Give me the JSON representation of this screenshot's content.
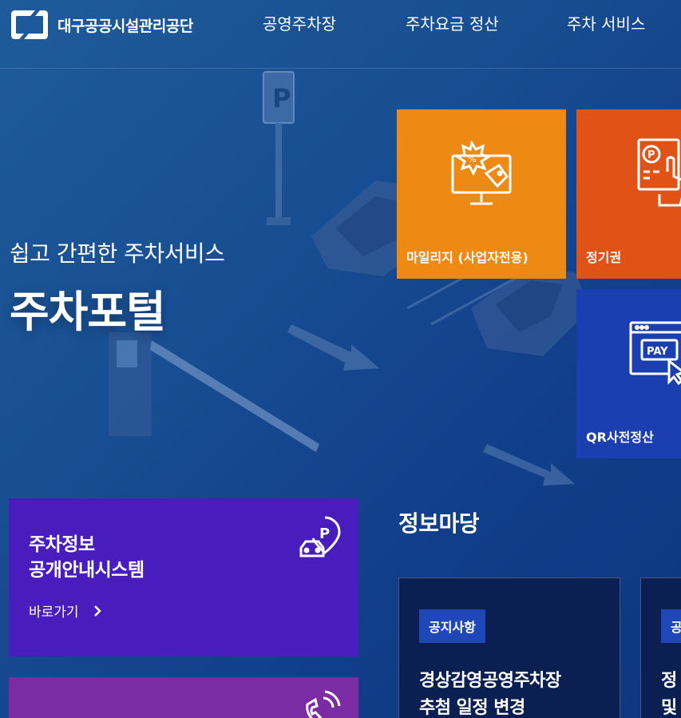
{
  "brand": {
    "name": "대구공공시설관리공단",
    "logo_icon": "brand-logo-icon"
  },
  "nav": [
    {
      "label": "공영주차장"
    },
    {
      "label": "주차요금 정산"
    },
    {
      "label": "주차 서비스"
    }
  ],
  "hero": {
    "subtitle": "쉽고 간편한 주차서비스",
    "title": "주차포털"
  },
  "tiles": [
    {
      "label": "마일리지 (사업자전용)",
      "icon": "discount-monitor-icon",
      "color": "#ee8a14"
    },
    {
      "label": "정기권",
      "icon": "parking-ticket-hand-icon",
      "color": "#e05216"
    },
    {
      "label": "QR사전정산",
      "icon": "pay-browser-icon",
      "color": "#1b3fb0"
    }
  ],
  "info_card": {
    "title_line1": "주차정보",
    "title_line2": "공개안내시스템",
    "link": "바로가기",
    "icon": "car-parking-pin-icon",
    "color": "#481cbd"
  },
  "call_card": {
    "icon": "phone-ring-icon",
    "color": "#7b2ba3"
  },
  "board": {
    "title": "정보마당",
    "notices": [
      {
        "badge": "공지사항",
        "title_line1": "경상감영공영주차장",
        "title_line2": "추첨 일정 변경"
      },
      {
        "badge": "공",
        "title_line1": "정",
        "title_line2": "및"
      }
    ]
  }
}
